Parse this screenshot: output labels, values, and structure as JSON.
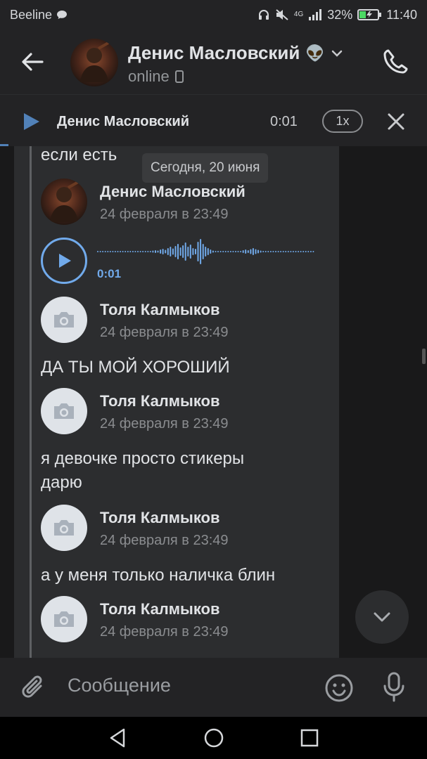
{
  "statusbar": {
    "carrier": "Beeline",
    "network": "4G",
    "battery": "32%",
    "time": "11:40"
  },
  "header": {
    "name": "Денис Масловский",
    "name_emoji": "👽",
    "status": "online"
  },
  "player": {
    "name": "Денис Масловский",
    "time": "0:01",
    "speed": "1x",
    "progress": 0.01
  },
  "chat": {
    "date_chip": "Сегодня, 20 июня",
    "messages": [
      {
        "text": "если есть"
      },
      {
        "author": "Денис Масловский",
        "date": "24 февраля в 23:49",
        "voice_time": "0:01"
      },
      {
        "author": "Толя Калмыков",
        "date": "24 февраля в 23:49"
      },
      {
        "text": "ДА ТЫ МОЙ ХОРОШИЙ"
      },
      {
        "author": "Толя Калмыков",
        "date": "24 февраля в 23:49"
      },
      {
        "text_line1": "я девочке просто стикеры",
        "text_line2": "дарю"
      },
      {
        "author": "Толя Калмыков",
        "date": "24 февраля в 23:49"
      },
      {
        "text": "а у меня только наличка блин"
      },
      {
        "author": "Толя Калмыков",
        "date": "24 февраля в 23:49"
      }
    ]
  },
  "compose": {
    "placeholder": "Сообщение"
  },
  "colors": {
    "accent": "#71aaeb",
    "player_play": "#5181b8",
    "background": "#19191a",
    "bubble": "#2c2d2f",
    "header": "#232325"
  },
  "icons": {
    "back": "arrow-left-icon",
    "call": "phone-icon",
    "play": "play-icon",
    "close": "close-icon",
    "camera": "camera-icon",
    "attach": "paperclip-icon",
    "emoji": "smile-icon",
    "mic": "microphone-icon",
    "scroll_down": "chevron-down-icon"
  }
}
